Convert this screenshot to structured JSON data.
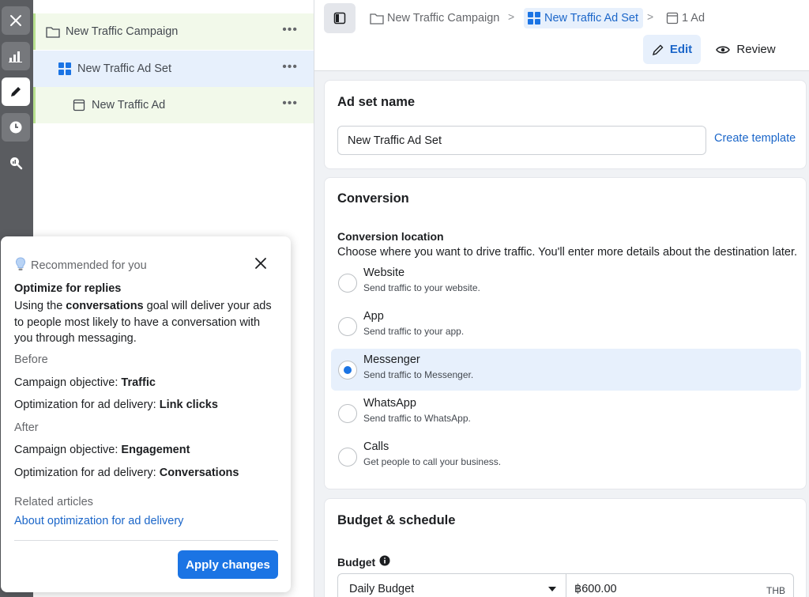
{
  "tree": {
    "campaign": "New Traffic Campaign",
    "adset": "New Traffic Ad Set",
    "ad": "New Traffic Ad",
    "more": "•••"
  },
  "recommendation": {
    "header": "Recommended for you",
    "title": "Optimize for replies",
    "body_prefix": "Using the ",
    "body_bold": "conversations",
    "body_suffix": " goal will deliver your ads to people most likely to have a conversation with you through messaging.",
    "before_label": "Before",
    "before_objective_label": "Campaign objective: ",
    "before_objective_value": "Traffic",
    "before_optimization_label": "Optimization for ad delivery: ",
    "before_optimization_value": "Link clicks",
    "after_label": "After",
    "after_objective_label": "Campaign objective: ",
    "after_objective_value": "Engagement",
    "after_optimization_label": "Optimization for ad delivery: ",
    "after_optimization_value": "Conversations",
    "related_label": "Related articles",
    "related_link": "About optimization for ad delivery",
    "apply_label": "Apply changes"
  },
  "breadcrumb": {
    "campaign": "New Traffic Campaign",
    "adset": "New Traffic Ad Set",
    "ad": "1 Ad",
    "separator": ">"
  },
  "toolbar": {
    "edit_label": "Edit",
    "review_label": "Review"
  },
  "adset_name": {
    "title": "Ad set name",
    "value": "New Traffic Ad Set",
    "create_template": "Create template"
  },
  "conversion": {
    "title": "Conversion",
    "location_label": "Conversion location",
    "location_desc": "Choose where you want to drive traffic. You'll enter more details about the destination later.",
    "options": [
      {
        "label": "Website",
        "sub": "Send traffic to your website."
      },
      {
        "label": "App",
        "sub": "Send traffic to your app."
      },
      {
        "label": "Messenger",
        "sub": "Send traffic to Messenger."
      },
      {
        "label": "WhatsApp",
        "sub": "Send traffic to WhatsApp."
      },
      {
        "label": "Calls",
        "sub": "Get people to call your business."
      }
    ],
    "selected": "Messenger"
  },
  "budget": {
    "title": "Budget & schedule",
    "label": "Budget",
    "type": "Daily Budget",
    "amount": "฿600.00",
    "currency": "THB"
  },
  "colors": {
    "accent": "#1b74e4",
    "link": "#1b66c9",
    "rail": "#5a5c60",
    "campaign_highlight": "#f2f9ea",
    "selected_highlight": "#e7f0fc"
  }
}
